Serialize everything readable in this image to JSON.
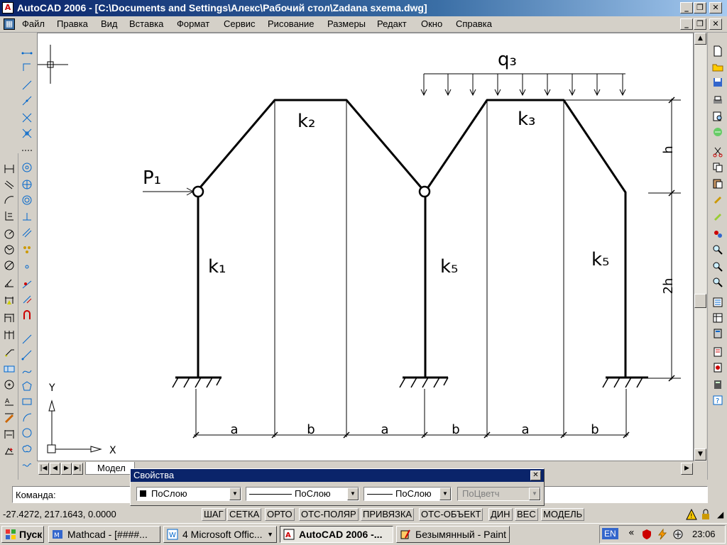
{
  "window": {
    "title": "AutoCAD 2006 - [C:\\Documents and Settings\\Алекс\\Рабочий стол\\Zadana sxema.dwg]",
    "app_icon_letter": "A"
  },
  "menu": [
    "Файл",
    "Правка",
    "Вид",
    "Вставка",
    "Формат",
    "Сервис",
    "Рисование",
    "Размеры",
    "Редакт",
    "Окно",
    "Справка"
  ],
  "drawing": {
    "labels": {
      "q3": "q₃",
      "p1": "P₁",
      "k1": "k₁",
      "k2": "k₂",
      "k3": "k₃",
      "k5_mid": "k₅",
      "k5_right": "k₅",
      "dim_h": "h",
      "dim_2h": "2h"
    },
    "bottom_dims": [
      "a",
      "b",
      "a",
      "b",
      "a",
      "b"
    ],
    "ucs": {
      "x": "X",
      "y": "Y"
    }
  },
  "layout_tabs": {
    "model": "Модел"
  },
  "properties_palette": {
    "title": "Свойства",
    "close": "✕",
    "color": "ПоСлою",
    "linetype": "ПоСлою",
    "lineweight": "ПоСлою",
    "plotstyle": "ПоЦветч"
  },
  "command": {
    "prompt": "Команда:"
  },
  "status": {
    "coords": "-27.4272, 217.1643, 0.0000",
    "toggles": [
      "ШАГ",
      "СЕТКА",
      "ОРТО",
      "ОТС-ПОЛЯР",
      "ПРИВЯЗКА",
      "ОТС-ОБЪЕКТ",
      "ДИН",
      "ВЕС",
      "МОДЕЛЬ"
    ]
  },
  "taskbar": {
    "start": "Пуск",
    "tasks": [
      "Mathcad - [####...",
      "4 Microsoft Offic...",
      "AutoCAD 2006 -...",
      "Безымянный - Paint"
    ],
    "lang": "EN",
    "arrows": "«",
    "clock": "23:06"
  },
  "colors": {
    "titlebar": "#0a246a",
    "face": "#d4d0c8",
    "canvas": "#ffffff"
  }
}
